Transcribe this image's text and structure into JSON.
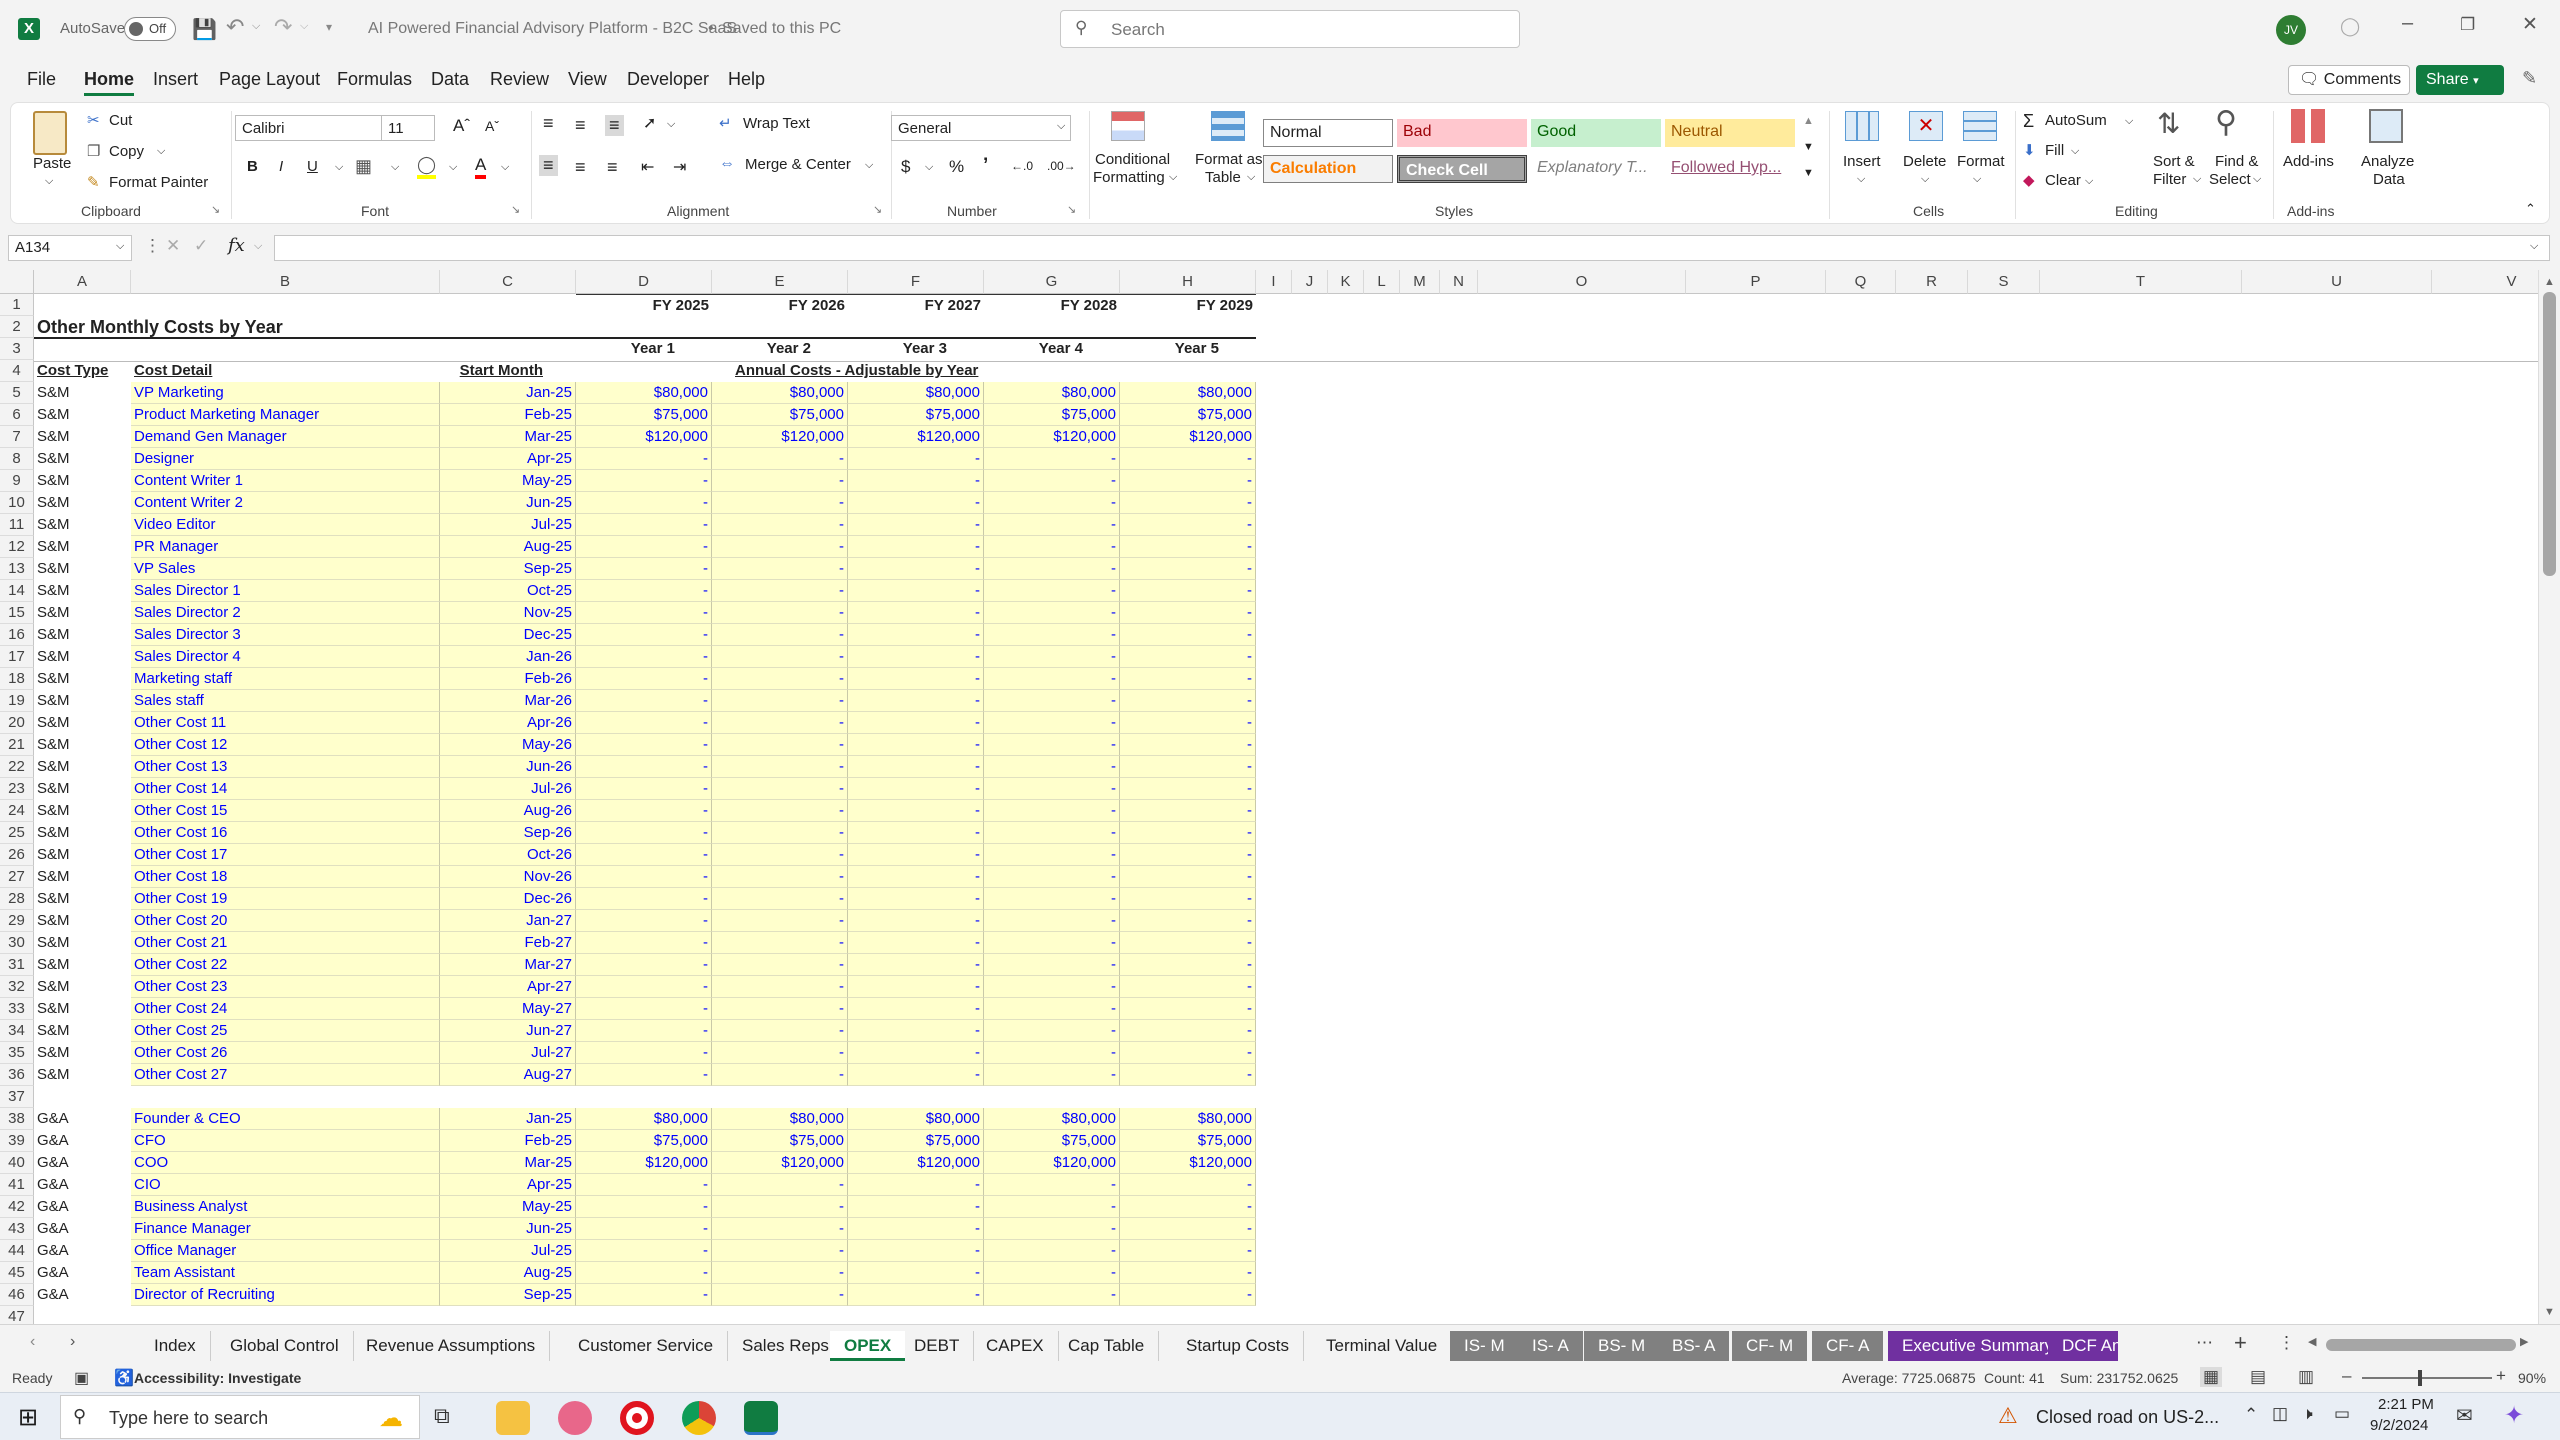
{
  "titlebar": {
    "autosave_label": "AutoSave",
    "autosave_state": "Off",
    "document_title": "AI Powered Financial Advisory Platform - B2C SaaS",
    "save_status": "Saved to this PC",
    "search_placeholder": "Search",
    "user_initials": "JV"
  },
  "menu": [
    "File",
    "Home",
    "Insert",
    "Page Layout",
    "Formulas",
    "Data",
    "Review",
    "View",
    "Developer",
    "Help"
  ],
  "menu_right": {
    "comments": "Comments",
    "share": "Share"
  },
  "ribbon": {
    "clipboard": {
      "paste": "Paste",
      "cut": "Cut",
      "copy": "Copy",
      "format_painter": "Format Painter",
      "group": "Clipboard"
    },
    "font": {
      "name": "Calibri",
      "size": "11",
      "group": "Font"
    },
    "alignment": {
      "wrap": "Wrap Text",
      "merge": "Merge & Center",
      "group": "Alignment"
    },
    "number": {
      "format": "General",
      "group": "Number"
    },
    "styles": {
      "cond_fmt_1": "Conditional",
      "cond_fmt_2": "Formatting",
      "fmt_table_1": "Format as",
      "fmt_table_2": "Table",
      "normal": "Normal",
      "bad": "Bad",
      "good": "Good",
      "neutral": "Neutral",
      "calculation": "Calculation",
      "check_cell": "Check Cell",
      "explanatory": "Explanatory T...",
      "followed": "Followed Hyp...",
      "group": "Styles"
    },
    "cells": {
      "insert": "Insert",
      "delete": "Delete",
      "format": "Format",
      "group": "Cells"
    },
    "editing": {
      "autosum": "AutoSum",
      "fill": "Fill",
      "clear": "Clear",
      "sort_1": "Sort &",
      "sort_2": "Filter",
      "find_1": "Find &",
      "find_2": "Select",
      "group": "Editing"
    },
    "addins": {
      "addins": "Add-ins",
      "analyze_1": "Analyze",
      "analyze_2": "Data",
      "group": "Add-ins"
    }
  },
  "formula_bar": {
    "name_box": "A134",
    "fx": "fx",
    "value": ""
  },
  "columns": [
    "A",
    "B",
    "C",
    "D",
    "E",
    "F",
    "G",
    "H",
    "I",
    "J",
    "K",
    "L",
    "M",
    "N",
    "O",
    "P",
    "Q",
    "R",
    "S",
    "T",
    "U",
    "V"
  ],
  "sheet": {
    "fy_labels": [
      "FY 2025",
      "FY 2026",
      "FY 2027",
      "FY 2028",
      "FY 2029"
    ],
    "title": "Other Monthly Costs by Year",
    "year_labels": [
      "Year 1",
      "Year 2",
      "Year 3",
      "Year 4",
      "Year 5"
    ],
    "header_cost_type": "Cost Type",
    "header_cost_detail": "Cost Detail",
    "header_start_month": "Start Month",
    "header_annual": "Annual Costs - Adjustable by Year",
    "rows": [
      {
        "n": "5",
        "type": "S&M",
        "detail": "VP Marketing",
        "start": "Jan-25",
        "v": [
          "$80,000",
          "$80,000",
          "$80,000",
          "$80,000",
          "$80,000"
        ]
      },
      {
        "n": "6",
        "type": "S&M",
        "detail": "Product Marketing Manager",
        "start": "Feb-25",
        "v": [
          "$75,000",
          "$75,000",
          "$75,000",
          "$75,000",
          "$75,000"
        ]
      },
      {
        "n": "7",
        "type": "S&M",
        "detail": "Demand Gen Manager",
        "start": "Mar-25",
        "v": [
          "$120,000",
          "$120,000",
          "$120,000",
          "$120,000",
          "$120,000"
        ]
      },
      {
        "n": "8",
        "type": "S&M",
        "detail": "Designer",
        "start": "Apr-25",
        "v": [
          "-",
          "-",
          "-",
          "-",
          "-"
        ]
      },
      {
        "n": "9",
        "type": "S&M",
        "detail": "Content Writer 1",
        "start": "May-25",
        "v": [
          "-",
          "-",
          "-",
          "-",
          "-"
        ]
      },
      {
        "n": "10",
        "type": "S&M",
        "detail": "Content Writer 2",
        "start": "Jun-25",
        "v": [
          "-",
          "-",
          "-",
          "-",
          "-"
        ]
      },
      {
        "n": "11",
        "type": "S&M",
        "detail": "Video Editor",
        "start": "Jul-25",
        "v": [
          "-",
          "-",
          "-",
          "-",
          "-"
        ]
      },
      {
        "n": "12",
        "type": "S&M",
        "detail": "PR Manager",
        "start": "Aug-25",
        "v": [
          "-",
          "-",
          "-",
          "-",
          "-"
        ]
      },
      {
        "n": "13",
        "type": "S&M",
        "detail": "VP Sales",
        "start": "Sep-25",
        "v": [
          "-",
          "-",
          "-",
          "-",
          "-"
        ]
      },
      {
        "n": "14",
        "type": "S&M",
        "detail": "Sales Director 1",
        "start": "Oct-25",
        "v": [
          "-",
          "-",
          "-",
          "-",
          "-"
        ]
      },
      {
        "n": "15",
        "type": "S&M",
        "detail": "Sales Director 2",
        "start": "Nov-25",
        "v": [
          "-",
          "-",
          "-",
          "-",
          "-"
        ]
      },
      {
        "n": "16",
        "type": "S&M",
        "detail": "Sales Director 3",
        "start": "Dec-25",
        "v": [
          "-",
          "-",
          "-",
          "-",
          "-"
        ]
      },
      {
        "n": "17",
        "type": "S&M",
        "detail": "Sales Director 4",
        "start": "Jan-26",
        "v": [
          "-",
          "-",
          "-",
          "-",
          "-"
        ]
      },
      {
        "n": "18",
        "type": "S&M",
        "detail": "Marketing staff",
        "start": "Feb-26",
        "v": [
          "-",
          "-",
          "-",
          "-",
          "-"
        ]
      },
      {
        "n": "19",
        "type": "S&M",
        "detail": "Sales staff",
        "start": "Mar-26",
        "v": [
          "-",
          "-",
          "-",
          "-",
          "-"
        ]
      },
      {
        "n": "20",
        "type": "S&M",
        "detail": "Other Cost 11",
        "start": "Apr-26",
        "v": [
          "-",
          "-",
          "-",
          "-",
          "-"
        ]
      },
      {
        "n": "21",
        "type": "S&M",
        "detail": "Other Cost 12",
        "start": "May-26",
        "v": [
          "-",
          "-",
          "-",
          "-",
          "-"
        ]
      },
      {
        "n": "22",
        "type": "S&M",
        "detail": "Other Cost 13",
        "start": "Jun-26",
        "v": [
          "-",
          "-",
          "-",
          "-",
          "-"
        ]
      },
      {
        "n": "23",
        "type": "S&M",
        "detail": "Other Cost 14",
        "start": "Jul-26",
        "v": [
          "-",
          "-",
          "-",
          "-",
          "-"
        ]
      },
      {
        "n": "24",
        "type": "S&M",
        "detail": "Other Cost 15",
        "start": "Aug-26",
        "v": [
          "-",
          "-",
          "-",
          "-",
          "-"
        ]
      },
      {
        "n": "25",
        "type": "S&M",
        "detail": "Other Cost 16",
        "start": "Sep-26",
        "v": [
          "-",
          "-",
          "-",
          "-",
          "-"
        ]
      },
      {
        "n": "26",
        "type": "S&M",
        "detail": "Other Cost 17",
        "start": "Oct-26",
        "v": [
          "-",
          "-",
          "-",
          "-",
          "-"
        ]
      },
      {
        "n": "27",
        "type": "S&M",
        "detail": "Other Cost 18",
        "start": "Nov-26",
        "v": [
          "-",
          "-",
          "-",
          "-",
          "-"
        ]
      },
      {
        "n": "28",
        "type": "S&M",
        "detail": "Other Cost 19",
        "start": "Dec-26",
        "v": [
          "-",
          "-",
          "-",
          "-",
          "-"
        ]
      },
      {
        "n": "29",
        "type": "S&M",
        "detail": "Other Cost 20",
        "start": "Jan-27",
        "v": [
          "-",
          "-",
          "-",
          "-",
          "-"
        ]
      },
      {
        "n": "30",
        "type": "S&M",
        "detail": "Other Cost 21",
        "start": "Feb-27",
        "v": [
          "-",
          "-",
          "-",
          "-",
          "-"
        ]
      },
      {
        "n": "31",
        "type": "S&M",
        "detail": "Other Cost 22",
        "start": "Mar-27",
        "v": [
          "-",
          "-",
          "-",
          "-",
          "-"
        ]
      },
      {
        "n": "32",
        "type": "S&M",
        "detail": "Other Cost 23",
        "start": "Apr-27",
        "v": [
          "-",
          "-",
          "-",
          "-",
          "-"
        ]
      },
      {
        "n": "33",
        "type": "S&M",
        "detail": "Other Cost 24",
        "start": "May-27",
        "v": [
          "-",
          "-",
          "-",
          "-",
          "-"
        ]
      },
      {
        "n": "34",
        "type": "S&M",
        "detail": "Other Cost 25",
        "start": "Jun-27",
        "v": [
          "-",
          "-",
          "-",
          "-",
          "-"
        ]
      },
      {
        "n": "35",
        "type": "S&M",
        "detail": "Other Cost 26",
        "start": "Jul-27",
        "v": [
          "-",
          "-",
          "-",
          "-",
          "-"
        ]
      },
      {
        "n": "36",
        "type": "S&M",
        "detail": "Other Cost 27",
        "start": "Aug-27",
        "v": [
          "-",
          "-",
          "-",
          "-",
          "-"
        ]
      },
      {
        "n": "37",
        "blank": true
      },
      {
        "n": "38",
        "type": "G&A",
        "detail": "Founder & CEO",
        "start": "Jan-25",
        "v": [
          "$80,000",
          "$80,000",
          "$80,000",
          "$80,000",
          "$80,000"
        ]
      },
      {
        "n": "39",
        "type": "G&A",
        "detail": "CFO",
        "start": "Feb-25",
        "v": [
          "$75,000",
          "$75,000",
          "$75,000",
          "$75,000",
          "$75,000"
        ]
      },
      {
        "n": "40",
        "type": "G&A",
        "detail": "COO",
        "start": "Mar-25",
        "v": [
          "$120,000",
          "$120,000",
          "$120,000",
          "$120,000",
          "$120,000"
        ]
      },
      {
        "n": "41",
        "type": "G&A",
        "detail": "CIO",
        "start": "Apr-25",
        "v": [
          "-",
          "-",
          "-",
          "-",
          "-"
        ]
      },
      {
        "n": "42",
        "type": "G&A",
        "detail": "Business Analyst",
        "start": "May-25",
        "v": [
          "-",
          "-",
          "-",
          "-",
          "-"
        ]
      },
      {
        "n": "43",
        "type": "G&A",
        "detail": "Finance Manager",
        "start": "Jun-25",
        "v": [
          "-",
          "-",
          "-",
          "-",
          "-"
        ]
      },
      {
        "n": "44",
        "type": "G&A",
        "detail": "Office Manager",
        "start": "Jul-25",
        "v": [
          "-",
          "-",
          "-",
          "-",
          "-"
        ]
      },
      {
        "n": "45",
        "type": "G&A",
        "detail": "Team Assistant",
        "start": "Aug-25",
        "v": [
          "-",
          "-",
          "-",
          "-",
          "-"
        ]
      },
      {
        "n": "46",
        "type": "G&A",
        "detail": "Director of Recruiting",
        "start": "Sep-25",
        "v": [
          "-",
          "-",
          "-",
          "-",
          "-"
        ]
      }
    ]
  },
  "tabs": [
    {
      "label": "Index",
      "style": "plain"
    },
    {
      "label": "Global Control",
      "style": "plain"
    },
    {
      "label": "Revenue Assumptions",
      "style": "plain"
    },
    {
      "label": "Customer Service",
      "style": "plain"
    },
    {
      "label": "Sales Reps",
      "style": "plain"
    },
    {
      "label": "OPEX",
      "style": "active"
    },
    {
      "label": "DEBT",
      "style": "plain"
    },
    {
      "label": "CAPEX",
      "style": "plain"
    },
    {
      "label": "Cap Table",
      "style": "plain"
    },
    {
      "label": "Startup Costs",
      "style": "plain"
    },
    {
      "label": "Terminal Value",
      "style": "plain"
    },
    {
      "label": "IS- M",
      "style": "grey"
    },
    {
      "label": "IS- A",
      "style": "grey"
    },
    {
      "label": "BS- M",
      "style": "grey"
    },
    {
      "label": "BS- A",
      "style": "grey"
    },
    {
      "label": "CF- M",
      "style": "grey"
    },
    {
      "label": "CF- A",
      "style": "grey"
    },
    {
      "label": "Executive Summary",
      "style": "purple"
    },
    {
      "label": "DCF An",
      "style": "purple"
    }
  ],
  "status": {
    "ready": "Ready",
    "accessibility": "Accessibility: Investigate",
    "average": "Average: 7725.06875",
    "count": "Count: 41",
    "sum": "Sum: 231752.0625",
    "zoom": "90%"
  },
  "taskbar": {
    "search_placeholder": "Type here to search",
    "notification": "Closed road on US-2...",
    "time": "2:21 PM",
    "date": "9/2/2024"
  },
  "colors": {
    "excel_green": "#107c41",
    "input_fill": "#ffffcc",
    "input_text": "#0000ff",
    "tab_grey": "#808080",
    "tab_purple": "#7030a0"
  }
}
